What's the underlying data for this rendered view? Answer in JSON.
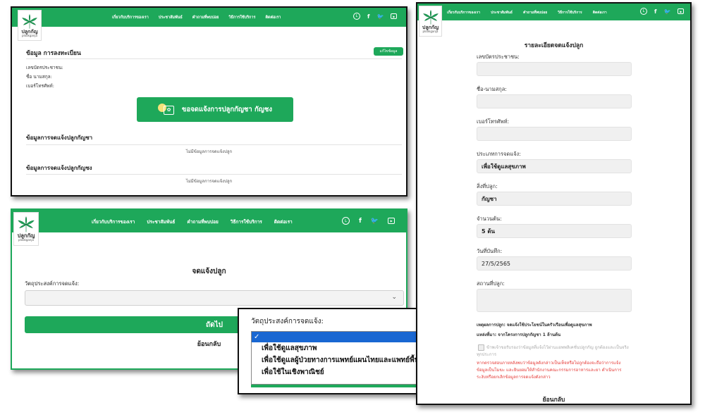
{
  "nav": {
    "links": [
      "เกี่ยวกับบริการของเรา",
      "ประชาสัมพันธ์",
      "คำถามที่พบบ่อย",
      "วิธีการใช้บริการ",
      "ติดต่อเรา"
    ],
    "icons": [
      "line-icon",
      "facebook-icon",
      "twitter-icon",
      "youtube-icon"
    ],
    "brand_color": "#1ea85a"
  },
  "logo": {
    "title": "ปลูกกัญ",
    "subtitle": "plookganja"
  },
  "panel1": {
    "section_title": "ข้อมูล การลงทะเบียน",
    "edit_button": "แก้ไขข้อมูล",
    "fields": [
      "เลขบัตรประชาชน:",
      "ชื่อ นามสกุล:",
      "เบอร์โทรศัพท์:"
    ],
    "main_button": "ขอจดแจ้งการปลูกกัญชา กัญชง",
    "cannabis_title": "ข้อมูลการจดแจ้งปลูกกัญชา",
    "cannabis_empty": "ไม่มีข้อมูลการจดแจ้งปลูก",
    "hemp_title": "ข้อมูลการจดแจ้งปลูกกัญชง",
    "hemp_empty": "ไม่มีข้อมูลการจดแจ้งปลูก"
  },
  "panel2": {
    "title": "จดแจ้งปลูก",
    "purpose_label": "วัตถุประสงค์การจดแจ้ง:",
    "purpose_value": "",
    "next_button": "ถัดไป",
    "back_link": "ย้อนกลับ"
  },
  "dropdown": {
    "label": "วัตถุประสงค์การจดแจ้ง:",
    "selected_mark": "✓",
    "options": [
      "เพื่อใช้ดูแลสุขภาพ",
      "เพื่อใช้ดูแลผู้ป่วยทางการแพทย์แผนไทยและแพทย์พื้นบ้าน",
      "เพื่อใช้ในเชิงพาณิชย์"
    ]
  },
  "panel3": {
    "title": "รายละเอียดจดแจ้งปลูก",
    "fields": [
      {
        "label": "เลขบัตรประชาชน:",
        "value": ""
      },
      {
        "label": "ชื่อ-นามสกุล:",
        "value": ""
      },
      {
        "label": "เบอร์โทรศัพท์:",
        "value": ""
      },
      {
        "label": "ประเภทการจดแจ้ง:",
        "value": "เพื่อใช้ดูแลสุขภาพ"
      },
      {
        "label": "สิ่งที่ปลูก:",
        "value": "กัญชา"
      },
      {
        "label": "จำนวนต้น:",
        "value": "5 ต้น"
      },
      {
        "label": "วันที่บันทึก:",
        "value": "27/5/2565"
      },
      {
        "label": "สถานที่ปลูก:",
        "value": ""
      }
    ],
    "reason": "เหตุผลการปลูก: จดแจ้งใช้ประโยชน์ในครัวเรือนเพื่อดูแลสุขภาพ",
    "source": "แหล่งที่มา: จากโครงการปลูกกัญชา 1 ล้านต้น",
    "consent": "ข้าพเจ้าขอรับรองว่าข้อมูลที่แจ้งไว้ผ่านแอพพลิเคชั่นปลูกกัญ ถูกต้องและเป็นจริงทุกประการ",
    "warning": "หากตรวจสอบภายหลังพบว่าข้อมูลดังกล่าวเป็นเท็จหรือไม่ถูกต้องจะถือว่าการแจ้งข้อมูลเป็นโมฆะ และยินยอมให้สำนักงานคณะกรรมการอาหารและยา ดำเนินการระงับหรือยกเลิกข้อมูลการจดแจ้งดังกล่าว",
    "back_link": "ย้อนกลับ",
    "warning_color": "#e53935"
  }
}
